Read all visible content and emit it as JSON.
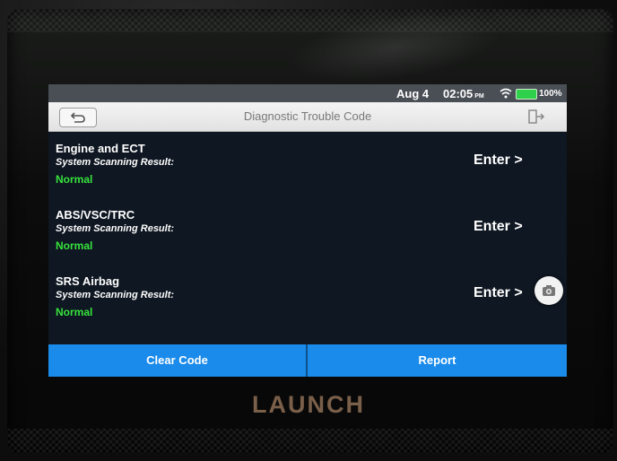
{
  "status_bar": {
    "date": "Aug 4",
    "time": "02:05",
    "ampm": "PM",
    "battery": "100%"
  },
  "title_bar": {
    "title": "Diagnostic Trouble Code"
  },
  "results": [
    {
      "name": "Engine and ECT",
      "label": "System Scanning Result:",
      "status": "Normal",
      "action": "Enter >"
    },
    {
      "name": "ABS/VSC/TRC",
      "label": "System Scanning Result:",
      "status": "Normal",
      "action": "Enter >"
    },
    {
      "name": "SRS Airbag",
      "label": "System Scanning Result:",
      "status": "Normal",
      "action": "Enter >"
    }
  ],
  "bottom_bar": {
    "clear_label": "Clear Code",
    "report_label": "Report"
  },
  "device": {
    "brand": "LAUNCH"
  },
  "colors": {
    "status_ok": "#36e23c",
    "accent": "#1a8bea",
    "screen_bg": "#0f1722"
  }
}
